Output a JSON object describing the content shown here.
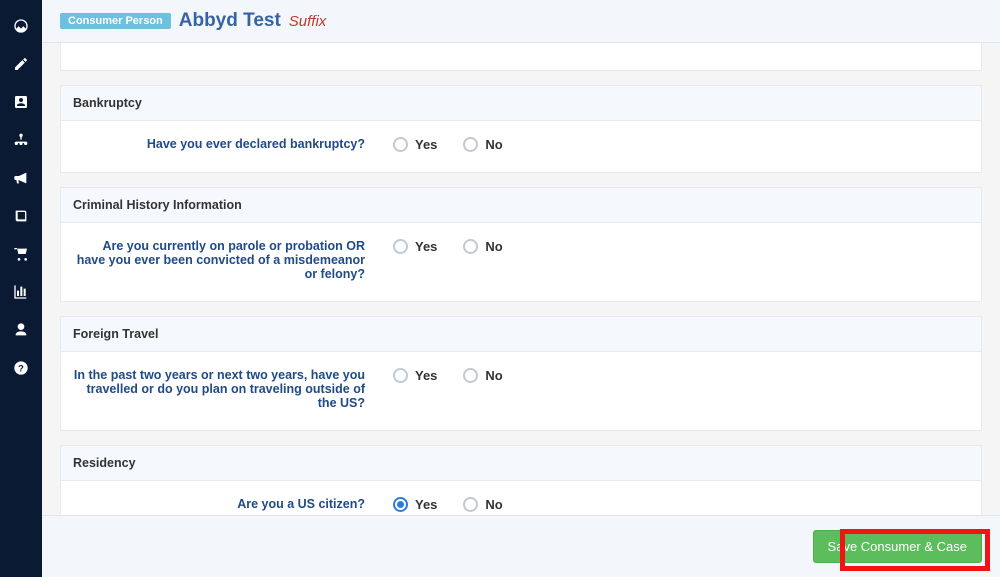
{
  "header": {
    "badge": "Consumer Person",
    "name": "Abbyd Test",
    "suffix": "Suffix"
  },
  "sections": {
    "bankruptcy": {
      "title": "Bankruptcy",
      "question": "Have you ever declared bankruptcy?",
      "yes": "Yes",
      "no": "No",
      "selected": null
    },
    "criminal": {
      "title": "Criminal History Information",
      "question": "Are you currently on parole or probation OR have you ever been convicted of a misdemeanor or felony?",
      "yes": "Yes",
      "no": "No",
      "selected": null
    },
    "travel": {
      "title": "Foreign Travel",
      "question": "In the past two years or next two years, have you travelled or do you plan on traveling outside of the US?",
      "yes": "Yes",
      "no": "No",
      "selected": null
    },
    "residency": {
      "title": "Residency",
      "question": "Are you a US citizen?",
      "yes": "Yes",
      "no": "No",
      "selected": "yes"
    }
  },
  "footer": {
    "save_label": "Save Consumer & Case"
  }
}
